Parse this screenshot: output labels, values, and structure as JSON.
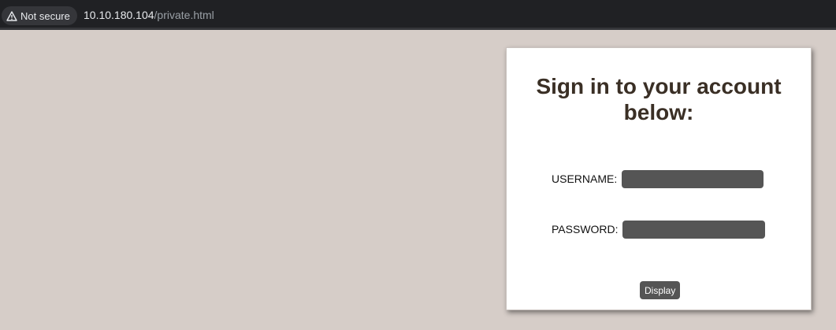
{
  "browser": {
    "security_label": "Not secure",
    "security_icon": "warning-triangle-icon",
    "url_host": "10.10.180.104",
    "url_path": "/private.html"
  },
  "login": {
    "title": "Sign in to your account below:",
    "username_label": "USERNAME:",
    "username_value": "",
    "password_label": "PASSWORD:",
    "password_value": "",
    "submit_label": "Display"
  },
  "colors": {
    "page_background": "#d6cdc8",
    "input_background": "#555555",
    "title_color": "#3a2f25"
  }
}
